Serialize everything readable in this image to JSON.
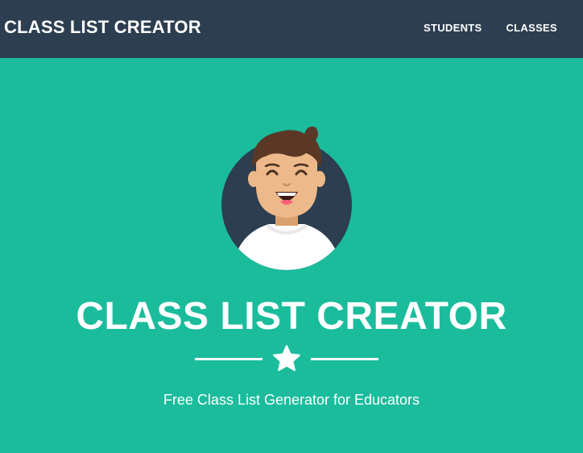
{
  "navbar": {
    "brand": "CLASS LIST CREATOR",
    "links": [
      {
        "label": "STUDENTS"
      },
      {
        "label": "CLASSES"
      }
    ]
  },
  "masthead": {
    "title": "CLASS LIST CREATOR",
    "subtitle": "Free Class List Generator for Educators",
    "avatar_icon": "smiling-boy-avatar-icon",
    "divider_icon": "star-icon"
  },
  "colors": {
    "navbar_bg": "#2c3e50",
    "masthead_bg": "#1abc9c",
    "text": "#ffffff",
    "avatar_circle": "#2c3e50"
  }
}
